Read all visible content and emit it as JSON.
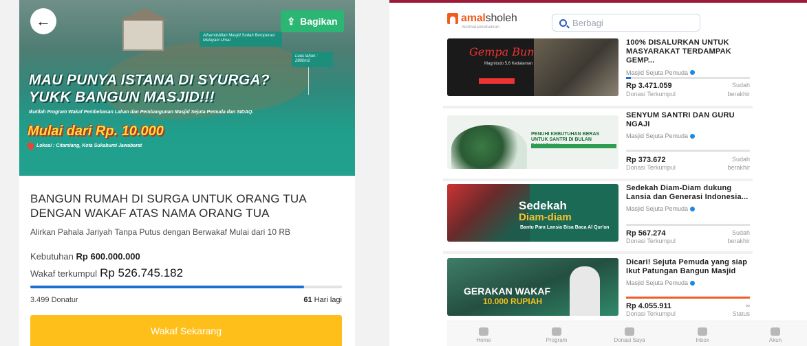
{
  "left": {
    "share_label": "Bagikan",
    "hero": {
      "tag1": "Alhamdulillah Masjid Sudah Beroperasi Melayani Umat",
      "tag2": "Luas lahan : 2800m2",
      "headline_1": "MAU PUNYA ISTANA DI SYURGA?",
      "headline_2": "YUKK BANGUN MASJID!!!",
      "sub": "Ikutilah Program Wakaf Pembebasan Lahan dan Pembangunan Masjid Sejuta Pemuda dan SIDAQ.",
      "price": "Mulai dari Rp. 10.000",
      "location": "Lokasi : Citamiang, Kota Sukabumi Jawabarat"
    },
    "title": "BANGUN RUMAH DI SURGA UNTUK ORANG TUA DENGAN WAKAF ATAS NAMA ORANG TUA",
    "description": "Alirkan Pahala Jariyah Tanpa Putus dengan Berwakaf Mulai dari 10 RB",
    "need_label": "Kebutuhan",
    "need_amount": "Rp 600.000.000",
    "collected_label": "Wakaf terkumpul",
    "collected_amount": "Rp 526.745.182",
    "progress_fraction": 0.878,
    "donors": "3.499 Donatur",
    "days_num": "61",
    "days_label": "Hari lagi",
    "cta_label": "Wakaf Sekarang"
  },
  "right": {
    "logo": {
      "brand_a": "amal",
      "brand_b": "sholeh",
      "tagline": "#embalankebaikan"
    },
    "search_placeholder": "Berbagi",
    "campaigns": [
      {
        "title": "100% DISALURKAN UNTUK MASYARAKAT TERDAMPAK GEMP...",
        "org": "Masjid Sejuta Pemuda",
        "amount": "Rp 3.471.059",
        "amount_label": "Donasi Terkumpul",
        "status_1": "Sudah",
        "status_2": "berakhir",
        "progress_fraction": 0.04,
        "img": {
          "t": "Gempa Bumi Cianjur",
          "s": "Magnitudo 5,6 Kedalaman 10Km",
          "b": "BANTU SEKARANG"
        }
      },
      {
        "title": "SENYUM SANTRI DAN GURU NGAJI",
        "org": "Masjid Sejuta Pemuda",
        "amount": "Rp 373.672",
        "amount_label": "Donasi Terkumpul",
        "status_1": "Sudah",
        "status_2": "berakhir",
        "progress_fraction": 0.0,
        "img": {
          "t": "PENUHI KEBUTUHAN BERAS UNTUK SANTRI DI BULAN RAMADHAN"
        }
      },
      {
        "title": "Sedekah Diam-Diam dukung Lansia dan Generasi Indonesia...",
        "org": "Masjid Sejuta Pemuda",
        "amount": "Rp 567.274",
        "amount_label": "Donasi Terkumpul",
        "status_1": "Sudah",
        "status_2": "berakhir",
        "progress_fraction": 0.0,
        "img": {
          "t": "Sedekah",
          "t2": "Diam-diam",
          "s": "Bantu Para Lansia Bisa Baca Al Qur'an"
        }
      },
      {
        "title": "Dicari! Sejuta Pemuda yang siap Ikut Patungan Bangun Masjid",
        "org": "Masjid Sejuta Pemuda",
        "amount": "Rp 4.055.911",
        "amount_label": "Donasi Terkumpul",
        "status_1": "∞",
        "status_2": "Status",
        "progress_fraction": 1.0,
        "img": {
          "t": "GERAKAN WAKAF",
          "t2": "10.000 RUPIAH"
        }
      }
    ],
    "nav": [
      {
        "label": "Home",
        "icon": "home-icon"
      },
      {
        "label": "Program",
        "icon": "program-icon"
      },
      {
        "label": "Donasi Saya",
        "icon": "donation-icon"
      },
      {
        "label": "Inbox",
        "icon": "inbox-icon"
      },
      {
        "label": "Akun",
        "icon": "account-icon"
      }
    ],
    "accent": "#f25c1f",
    "top_border_color": "#9c1b3a"
  }
}
